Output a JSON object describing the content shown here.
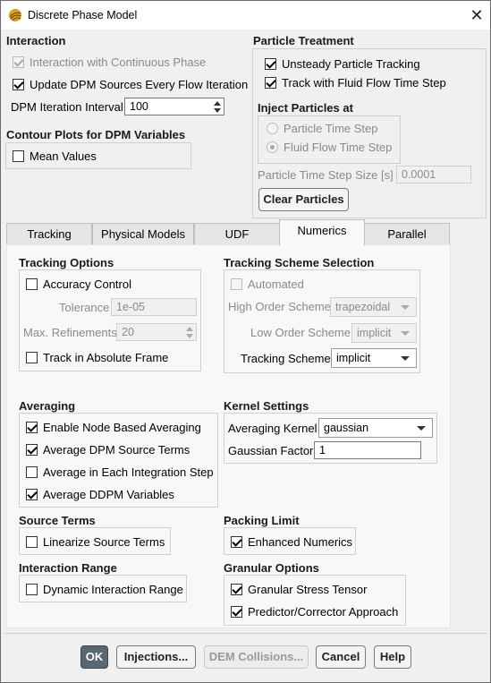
{
  "window": {
    "title": "Discrete Phase Model"
  },
  "interaction": {
    "heading": "Interaction",
    "continuous_phase": {
      "label": "Interaction with Continuous Phase",
      "checked": true,
      "disabled": true
    },
    "update_sources": {
      "label": "Update DPM Sources Every Flow Iteration",
      "checked": true
    },
    "iteration_interval": {
      "label": "DPM Iteration Interval",
      "value": "100"
    }
  },
  "contour": {
    "heading": "Contour Plots for DPM Variables",
    "mean_values": {
      "label": "Mean Values",
      "checked": false
    }
  },
  "particle_treatment": {
    "heading": "Particle Treatment",
    "unsteady": {
      "label": "Unsteady Particle Tracking",
      "checked": true
    },
    "fluid_time_step": {
      "label": "Track with Fluid Flow Time Step",
      "checked": true
    },
    "inject_heading": "Inject Particles at",
    "particle_time_step": {
      "label": "Particle Time Step",
      "selected": false
    },
    "fluid_flow_time_step": {
      "label": "Fluid Flow Time Step",
      "selected": true
    },
    "time_step_size": {
      "label": "Particle Time Step Size [s]",
      "value": "0.0001"
    },
    "clear_button": "Clear Particles"
  },
  "tabs": [
    {
      "label": "Tracking",
      "active": false
    },
    {
      "label": "Physical Models",
      "active": false
    },
    {
      "label": "UDF",
      "active": false
    },
    {
      "label": "Numerics",
      "active": true
    },
    {
      "label": "Parallel",
      "active": false
    }
  ],
  "numerics": {
    "tracking_options": {
      "heading": "Tracking Options",
      "accuracy_control": {
        "label": "Accuracy Control",
        "checked": false
      },
      "tolerance": {
        "label": "Tolerance",
        "value": "1e-05"
      },
      "max_refinements": {
        "label": "Max. Refinements",
        "value": "20"
      },
      "absolute_frame": {
        "label": "Track in Absolute Frame",
        "checked": false
      }
    },
    "scheme_selection": {
      "heading": "Tracking Scheme Selection",
      "automated": {
        "label": "Automated",
        "checked": false
      },
      "high_order": {
        "label": "High Order Scheme",
        "value": "trapezoidal"
      },
      "low_order": {
        "label": "Low Order Scheme",
        "value": "implicit"
      },
      "tracking_scheme": {
        "label": "Tracking Scheme",
        "value": "implicit"
      }
    },
    "averaging": {
      "heading": "Averaging",
      "node_based": {
        "label": "Enable Node Based Averaging",
        "checked": true
      },
      "dpm_source": {
        "label": "Average DPM Source Terms",
        "checked": true
      },
      "each_step": {
        "label": "Average in Each Integration Step",
        "checked": false
      },
      "ddpm_vars": {
        "label": "Average DDPM Variables",
        "checked": true
      }
    },
    "kernel": {
      "heading": "Kernel Settings",
      "averaging_kernel": {
        "label": "Averaging Kernel",
        "value": "gaussian"
      },
      "gaussian_factor": {
        "label": "Gaussian Factor",
        "value": "1"
      }
    },
    "source_terms": {
      "heading": "Source Terms",
      "linearize": {
        "label": "Linearize Source Terms",
        "checked": false
      }
    },
    "packing_limit": {
      "heading": "Packing Limit",
      "enhanced": {
        "label": "Enhanced Numerics",
        "checked": true
      }
    },
    "interaction_range": {
      "heading": "Interaction Range",
      "dynamic": {
        "label": "Dynamic Interaction Range",
        "checked": false
      }
    },
    "granular": {
      "heading": "Granular Options",
      "stress_tensor": {
        "label": "Granular Stress Tensor",
        "checked": true
      },
      "predictor": {
        "label": "Predictor/Corrector Approach",
        "checked": true
      }
    }
  },
  "buttons": {
    "ok": "OK",
    "injections": "Injections...",
    "dem": "DEM Collisions...",
    "cancel": "Cancel",
    "help": "Help"
  }
}
